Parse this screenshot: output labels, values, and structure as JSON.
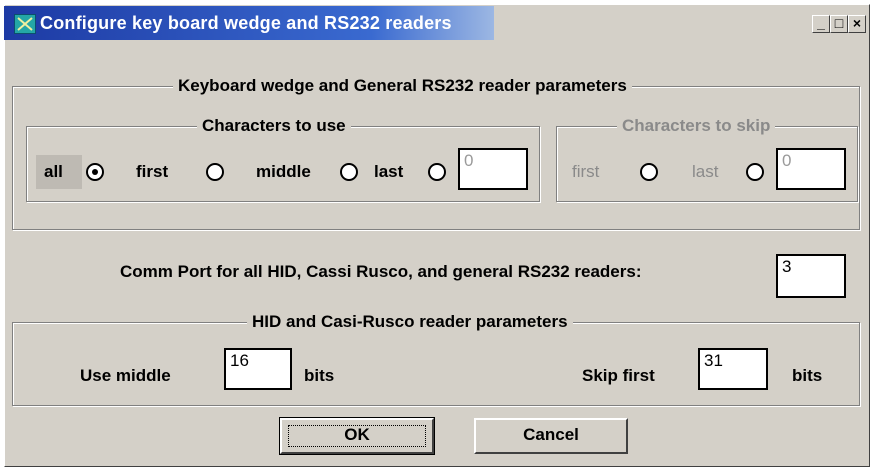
{
  "window": {
    "title": "Configure key board wedge and RS232 readers",
    "minimize_label": "_",
    "maximize_label": "□",
    "close_label": "×"
  },
  "wedge_group": {
    "title": "Keyboard wedge and General RS232 reader parameters",
    "use_group": {
      "title": "Characters to use",
      "options": [
        "all",
        "first",
        "middle",
        "last"
      ],
      "selected": "all",
      "count_value": "0"
    },
    "skip_group": {
      "title": "Characters to skip",
      "options": [
        "first",
        "last"
      ],
      "count_value": "0",
      "enabled": false
    }
  },
  "comm_port": {
    "label": "Comm Port for all HID, Cassi Rusco, and general RS232 readers:",
    "value": "3"
  },
  "hid_group": {
    "title": "HID and Casi-Rusco reader parameters",
    "use_middle_label": "Use middle",
    "use_middle_value": "16",
    "bits_label_1": "bits",
    "skip_first_label": "Skip first",
    "skip_first_value": "31",
    "bits_label_2": "bits"
  },
  "buttons": {
    "ok_label": "OK",
    "cancel_label": "Cancel"
  }
}
